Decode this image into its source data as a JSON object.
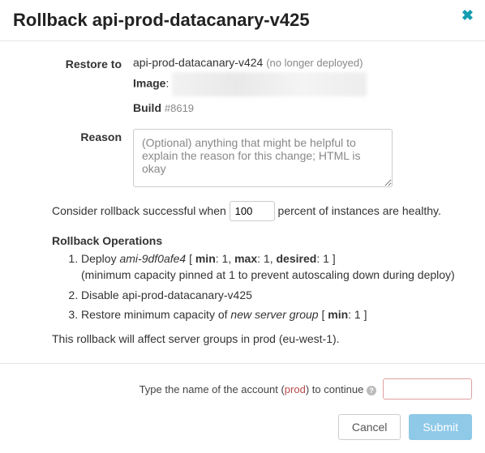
{
  "header": {
    "title": "Rollback api-prod-datacanary-v425"
  },
  "restore": {
    "label": "Restore to",
    "target": "api-prod-datacanary-v424",
    "target_note": "(no longer deployed)",
    "image_label": "Image",
    "build_label": "Build",
    "build_number": "#8619"
  },
  "reason": {
    "label": "Reason",
    "placeholder": "(Optional) anything that might be helpful to explain the reason for this change; HTML is okay",
    "value": ""
  },
  "threshold": {
    "prefix": "Consider rollback successful when",
    "value": "100",
    "suffix": "percent of instances are healthy."
  },
  "ops": {
    "title": "Rollback Operations",
    "items": [
      {
        "prefix": "Deploy ",
        "ami": "ami-9df0afe4",
        "spec_open": " [ ",
        "min_l": "min",
        "min_v": ": 1, ",
        "max_l": "max",
        "max_v": ": 1, ",
        "des_l": "desired",
        "des_v": ": 1 ]",
        "note": "(minimum capacity pinned at 1 to prevent autoscaling down during deploy)"
      },
      {
        "text": "Disable api-prod-datacanary-v425"
      },
      {
        "prefix": "Restore minimum capacity of ",
        "group": "new server group",
        "spec_open": " [ ",
        "min_l": "min",
        "min_v": ": 1 ]"
      }
    ]
  },
  "affect": {
    "text": "This rollback will affect server groups in prod (eu-west-1)."
  },
  "confirm": {
    "prefix": "Type the name of the account (",
    "account": "prod",
    "suffix": ") to continue",
    "value": ""
  },
  "buttons": {
    "cancel": "Cancel",
    "submit": "Submit"
  }
}
